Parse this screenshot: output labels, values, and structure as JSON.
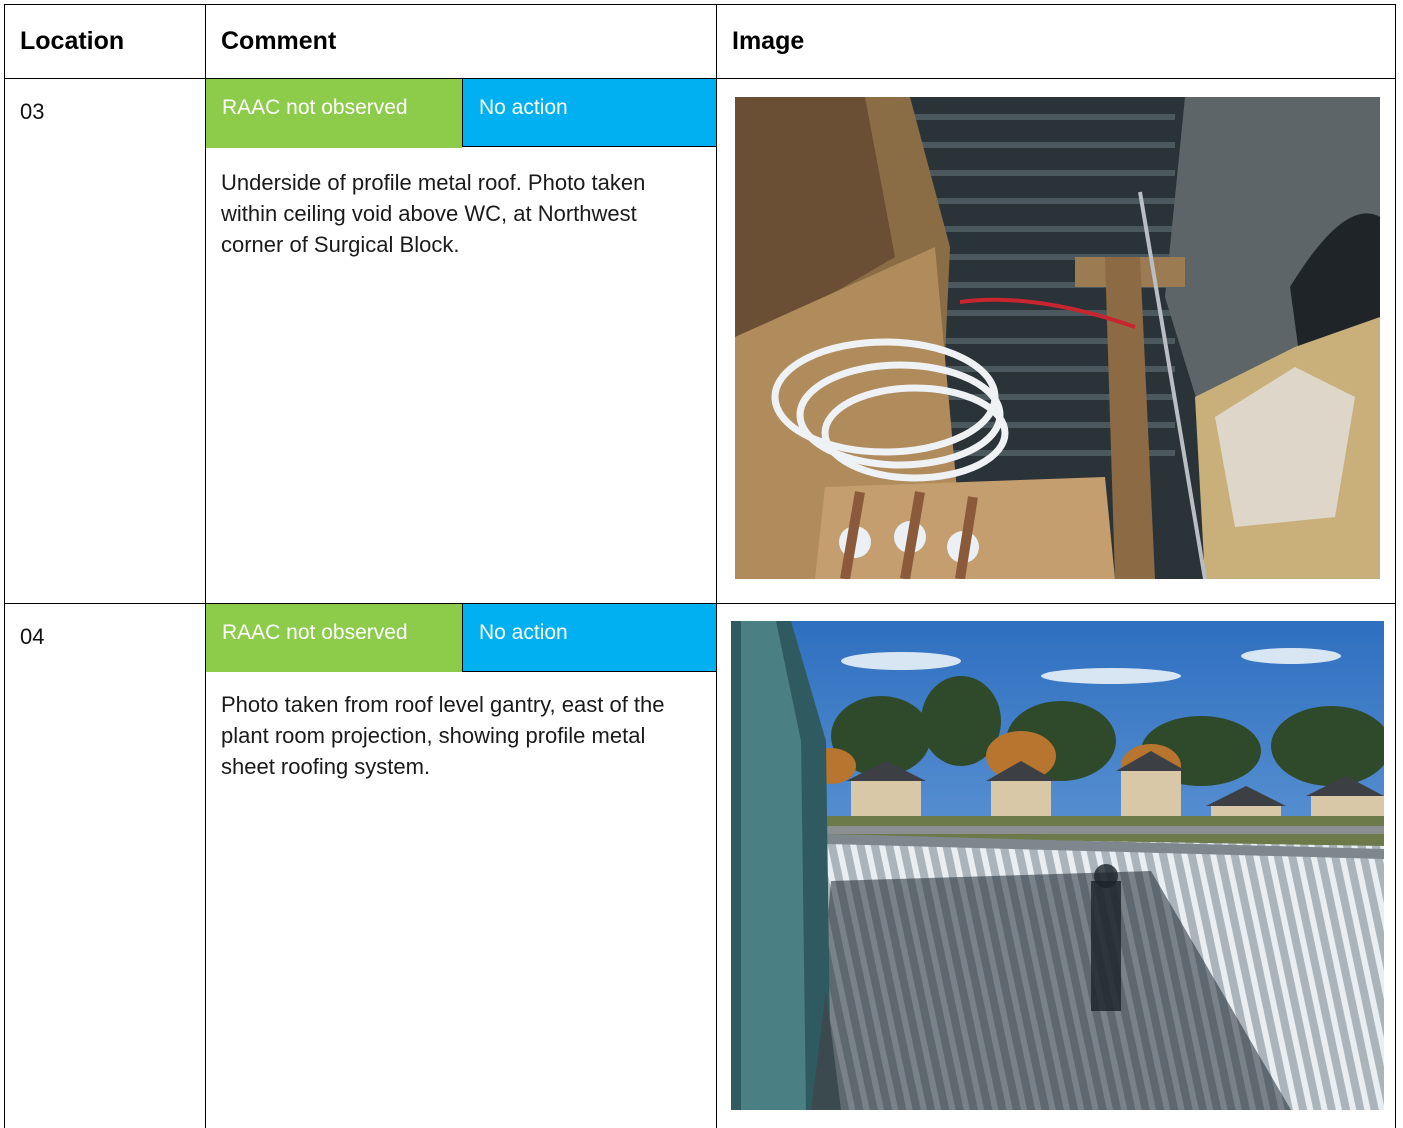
{
  "header": {
    "location": "Location",
    "comment": "Comment",
    "image": "Image"
  },
  "rows": [
    {
      "location": "03",
      "status": "RAAC not observed",
      "action": "No action",
      "comment": "Underside of profile metal roof. Photo taken within ceiling void above WC, at Northwest corner of Surgical Block.",
      "image": "ceiling-void-photo"
    },
    {
      "location": "04",
      "status": "RAAC not observed",
      "action": "No action",
      "comment": "Photo taken from roof level gantry, east of the plant room projection, showing profile metal sheet roofing system.",
      "image": "roof-gantry-photo"
    }
  ],
  "colors": {
    "status_green": "#8dcb4b",
    "action_blue": "#00b0f0",
    "border": "#000000"
  }
}
